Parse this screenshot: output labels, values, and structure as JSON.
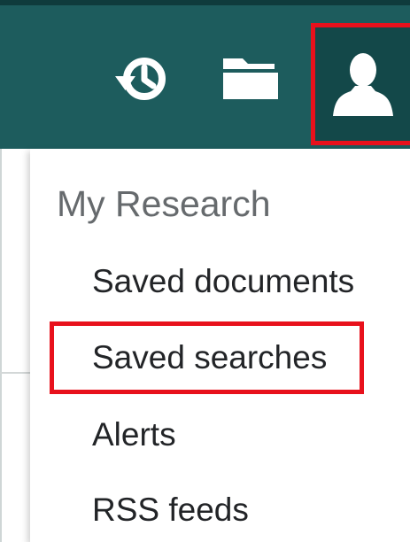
{
  "colors": {
    "toolbar_bg": "#1d5c5d",
    "toolbar_active_bg": "#134849",
    "icon": "#ffffff",
    "highlight": "#e8111c",
    "heading_text": "#666a6d",
    "item_text": "#222427"
  },
  "toolbar": {
    "icons": [
      "history-icon",
      "folder-icon",
      "user-icon"
    ]
  },
  "menu": {
    "heading": "My Research",
    "items": [
      {
        "label": "Saved documents"
      },
      {
        "label": "Saved searches"
      },
      {
        "label": "Alerts"
      },
      {
        "label": "RSS feeds"
      }
    ]
  }
}
